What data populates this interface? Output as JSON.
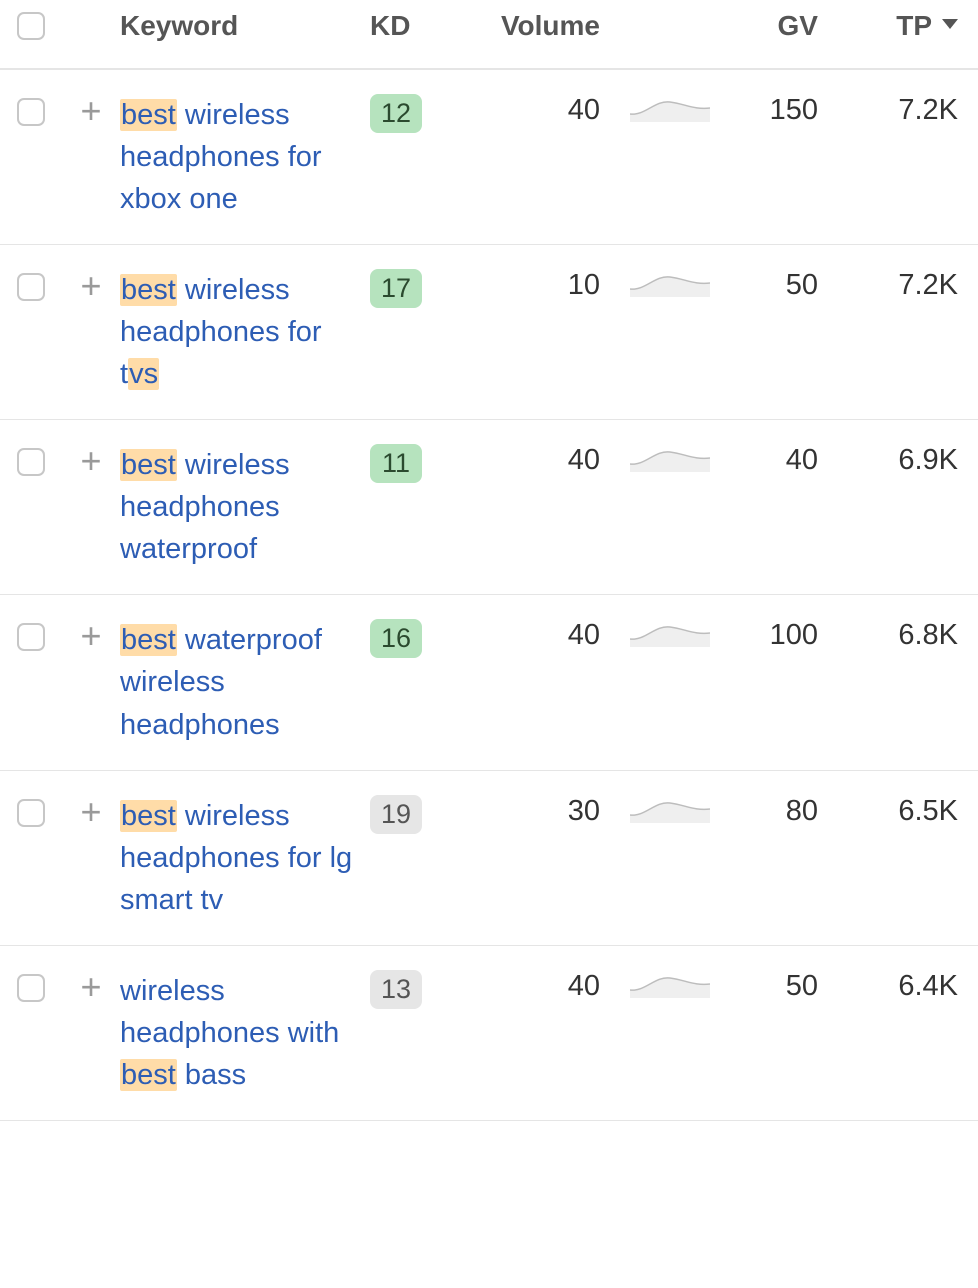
{
  "highlight_terms": [
    "best",
    "vs"
  ],
  "columns": {
    "keyword": "Keyword",
    "kd": "KD",
    "volume": "Volume",
    "gv": "GV",
    "tp": "TP"
  },
  "sorted_column": "tp",
  "sorted_dir": "desc",
  "rows": [
    {
      "keyword": "best wireless headphones for xbox one",
      "kd": 12,
      "kd_tier": "green",
      "volume": 40,
      "gv": 150,
      "tp": "7.2K"
    },
    {
      "keyword": "best wireless headphones for tvs",
      "kd": 17,
      "kd_tier": "green",
      "volume": 10,
      "gv": 50,
      "tp": "7.2K"
    },
    {
      "keyword": "best wireless headphones waterproof",
      "kd": 11,
      "kd_tier": "green",
      "volume": 40,
      "gv": 40,
      "tp": "6.9K"
    },
    {
      "keyword": "best waterproof wireless headphones",
      "kd": 16,
      "kd_tier": "green",
      "volume": 40,
      "gv": 100,
      "tp": "6.8K"
    },
    {
      "keyword": "best wireless headphones for lg smart tv",
      "kd": 19,
      "kd_tier": "gray",
      "volume": 30,
      "gv": 80,
      "tp": "6.5K"
    },
    {
      "keyword": "wireless headphones with best bass",
      "kd": 13,
      "kd_tier": "gray",
      "volume": 40,
      "gv": 50,
      "tp": "6.4K"
    }
  ]
}
